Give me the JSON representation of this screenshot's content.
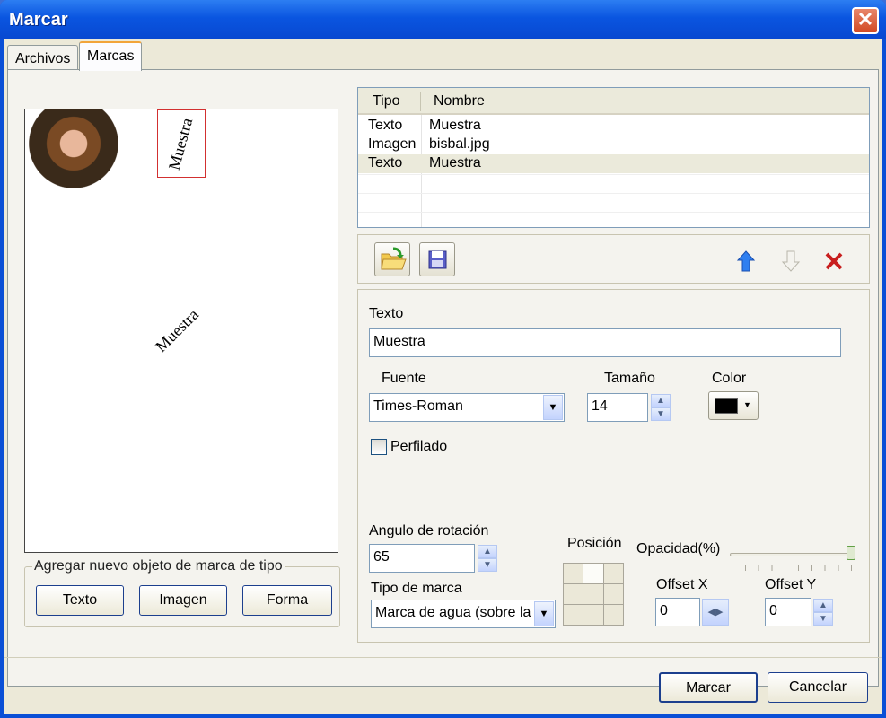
{
  "window": {
    "title": "Marcar"
  },
  "tabs": [
    {
      "label": "Archivos"
    },
    {
      "label": "Marcas"
    }
  ],
  "preview": {
    "watermark_top": "Muestra",
    "watermark_center": "Muestra"
  },
  "add_group": {
    "label": "Agregar nuevo objeto de marca de tipo",
    "buttons": [
      "Texto",
      "Imagen",
      "Forma"
    ]
  },
  "list": {
    "columns": [
      "Tipo",
      "Nombre"
    ],
    "rows": [
      {
        "tipo": "Texto",
        "nombre": "Muestra"
      },
      {
        "tipo": "Imagen",
        "nombre": "bisbal.jpg"
      },
      {
        "tipo": "Texto",
        "nombre": "Muestra"
      }
    ]
  },
  "props": {
    "texto_label": "Texto",
    "texto_value": "Muestra",
    "fuente_label": "Fuente",
    "fuente_value": "Times-Roman",
    "tamano_label": "Tamaño",
    "tamano_value": "14",
    "color_label": "Color",
    "color_value": "#000000",
    "perfilado_label": "Perfilado",
    "angulo_label": "Angulo de rotación",
    "angulo_value": "65",
    "posicion_label": "Posición",
    "opacidad_label": "Opacidad(%)",
    "opacidad_percent": 100,
    "tipo_marca_label": "Tipo de marca",
    "tipo_marca_value": "Marca de agua (sobre la",
    "offsetx_label": "Offset X",
    "offsetx_value": "0",
    "offsety_label": "Offset Y",
    "offsety_value": "0"
  },
  "footer": {
    "marcar": "Marcar",
    "cancelar": "Cancelar"
  }
}
